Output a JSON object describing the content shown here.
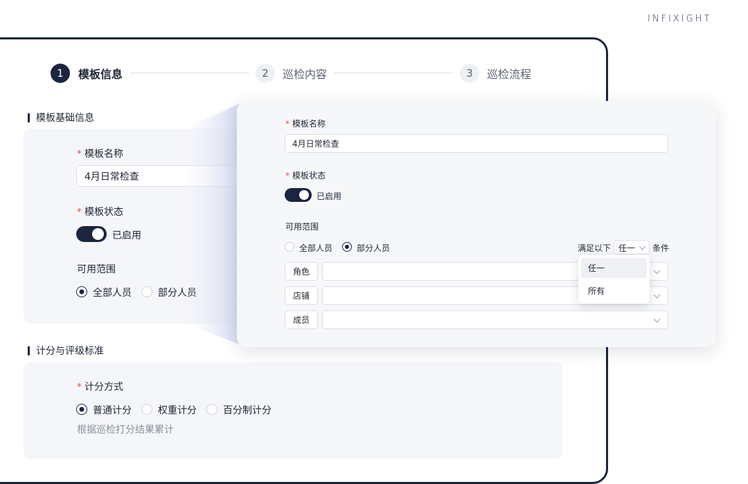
{
  "brand": {
    "logo_text": "INFIXIGHT"
  },
  "steps": [
    {
      "number": "1",
      "label": "模板信息",
      "active": true
    },
    {
      "number": "2",
      "label": "巡检内容",
      "active": false
    },
    {
      "number": "3",
      "label": "巡检流程",
      "active": false
    }
  ],
  "basic_info": {
    "section_title": "模板基础信息",
    "name_label": "模板名称",
    "name_value": "4月日常检查",
    "status_label": "模板状态",
    "status_text": "已启用",
    "status_on": true,
    "scope_label": "可用范围",
    "scope_options": [
      "全部人员",
      "部分人员"
    ],
    "scope_selected": "全部人员"
  },
  "scoring": {
    "section_title": "计分与评级标准",
    "method_label": "计分方式",
    "method_options": [
      "普通计分",
      "权重计分",
      "百分制计分"
    ],
    "method_selected": "普通计分",
    "hint": "根据巡检打分结果累计"
  },
  "zoom_card": {
    "name_label": "模板名称",
    "name_value": "4月日常检查",
    "status_label": "模板状态",
    "status_text": "已启用",
    "scope_label": "可用范围",
    "scope_options": [
      "全部人员",
      "部分人员"
    ],
    "scope_selected": "部分人员",
    "condition_prefix": "满足以下",
    "condition_value": "任一",
    "condition_suffix": "条件",
    "filters": [
      "角色",
      "店铺",
      "成员"
    ],
    "dropdown_options": [
      "任一",
      "所有"
    ],
    "dropdown_highlighted": "任一"
  },
  "colors": {
    "accent": "#1b2540",
    "required": "#e0584f",
    "panel": "#f5f6f9"
  }
}
